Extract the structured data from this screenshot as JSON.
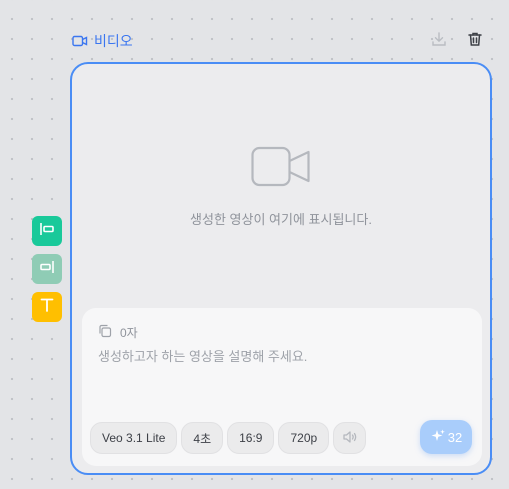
{
  "node": {
    "title": "비디오",
    "icons": {
      "title": "video-camera-icon",
      "download": "download-icon",
      "delete": "trash-icon"
    }
  },
  "preview": {
    "placeholder_text": "생성한 영상이 여기에 표시됩니다.",
    "icon": "video-camera-icon"
  },
  "prompt": {
    "char_count": "0자",
    "placeholder": "생성하고자 하는 영상을 설명해 주세요."
  },
  "options": {
    "model": "Veo 3.1 Lite",
    "duration": "4초",
    "aspect_ratio": "16:9",
    "resolution": "720p",
    "audio_icon": "speaker-icon"
  },
  "generate": {
    "cost": "32",
    "icon": "sparkle-icon"
  },
  "left_tools": [
    {
      "name": "align-left-tool",
      "color": "#19c99a",
      "icon": "align-left-icon"
    },
    {
      "name": "align-right-tool",
      "color": "#8fccb5",
      "icon": "align-right-icon"
    },
    {
      "name": "text-tool",
      "color": "#ffbf00",
      "icon": "text-t-icon"
    }
  ],
  "colors": {
    "accent": "#4a8df5",
    "title": "#3b76f0",
    "generate": "#a9cdfb"
  }
}
